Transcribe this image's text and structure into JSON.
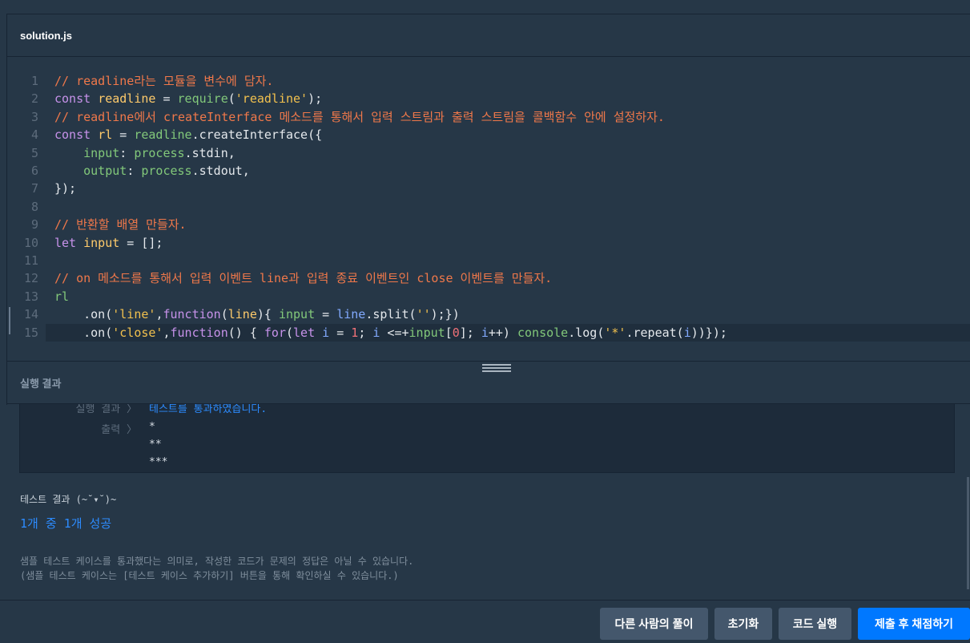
{
  "editor": {
    "file_name": "solution.js",
    "active_line": 15,
    "lines": [
      {
        "no": "1",
        "tokens": [
          [
            "c",
            "// readline라는 모듈을 변수에 담자."
          ]
        ]
      },
      {
        "no": "2",
        "tokens": [
          [
            "k",
            "const "
          ],
          [
            "v",
            "readline"
          ],
          [
            "p",
            " = "
          ],
          [
            "f",
            "require"
          ],
          [
            "p",
            "("
          ],
          [
            "s",
            "'readline'"
          ],
          [
            "p",
            ");"
          ]
        ]
      },
      {
        "no": "3",
        "tokens": [
          [
            "c",
            "// readline에서 createInterface 메소드를 통해서 입력 스트림과 출력 스트림을 콜백함수 안에 설정하자."
          ]
        ]
      },
      {
        "no": "4",
        "tokens": [
          [
            "k",
            "const "
          ],
          [
            "v",
            "rl"
          ],
          [
            "p",
            " = "
          ],
          [
            "f",
            "readline"
          ],
          [
            "p",
            ".createInterface({"
          ]
        ]
      },
      {
        "no": "5",
        "tokens": [
          [
            "p",
            "    "
          ],
          [
            "f",
            "input"
          ],
          [
            "p",
            ": "
          ],
          [
            "f",
            "process"
          ],
          [
            "p",
            ".stdin,"
          ]
        ]
      },
      {
        "no": "6",
        "tokens": [
          [
            "p",
            "    "
          ],
          [
            "f",
            "output"
          ],
          [
            "p",
            ": "
          ],
          [
            "f",
            "process"
          ],
          [
            "p",
            ".stdout,"
          ]
        ]
      },
      {
        "no": "7",
        "tokens": [
          [
            "p",
            "});"
          ]
        ]
      },
      {
        "no": "8",
        "tokens": []
      },
      {
        "no": "9",
        "tokens": [
          [
            "c",
            "// 반환할 배열 만들자."
          ]
        ]
      },
      {
        "no": "10",
        "tokens": [
          [
            "k",
            "let "
          ],
          [
            "v",
            "input"
          ],
          [
            "p",
            " = [];"
          ]
        ]
      },
      {
        "no": "11",
        "tokens": []
      },
      {
        "no": "12",
        "tokens": [
          [
            "c",
            "// on 메소드를 통해서 입력 이벤트 line과 입력 종료 이벤트인 close 이벤트를 만들자."
          ]
        ]
      },
      {
        "no": "13",
        "tokens": [
          [
            "f",
            "rl"
          ]
        ]
      },
      {
        "no": "14",
        "tokens": [
          [
            "p",
            "    .on("
          ],
          [
            "s",
            "'line'"
          ],
          [
            "p",
            ","
          ],
          [
            "k",
            "function"
          ],
          [
            "p",
            "("
          ],
          [
            "v",
            "line"
          ],
          [
            "p",
            "){ "
          ],
          [
            "f",
            "input"
          ],
          [
            "p",
            " = "
          ],
          [
            "b",
            "line"
          ],
          [
            "p",
            ".split("
          ],
          [
            "s",
            "''"
          ],
          [
            "p",
            ");})"
          ]
        ]
      },
      {
        "no": "15",
        "tokens": [
          [
            "p",
            "    .on("
          ],
          [
            "s",
            "'close'"
          ],
          [
            "p",
            ","
          ],
          [
            "k",
            "function"
          ],
          [
            "p",
            "() { "
          ],
          [
            "k",
            "for"
          ],
          [
            "p",
            "("
          ],
          [
            "k",
            "let "
          ],
          [
            "b",
            "i"
          ],
          [
            "p",
            " = "
          ],
          [
            "n",
            "1"
          ],
          [
            "p",
            "; "
          ],
          [
            "b",
            "i"
          ],
          [
            "p",
            " <=+"
          ],
          [
            "f",
            "input"
          ],
          [
            "p",
            "["
          ],
          [
            "n",
            "0"
          ],
          [
            "p",
            "]; "
          ],
          [
            "b",
            "i"
          ],
          [
            "p",
            "++) "
          ],
          [
            "f",
            "console"
          ],
          [
            "p",
            ".log("
          ],
          [
            "s",
            "'*'"
          ],
          [
            "p",
            ".repeat("
          ],
          [
            "b",
            "i"
          ],
          [
            "p",
            "))});"
          ]
        ]
      }
    ]
  },
  "result": {
    "title": "실행 결과",
    "run_label": "실행 결과 〉",
    "run_value": "테스트를 통과하였습니다.",
    "output_label": "출력 〉",
    "output_lines": [
      "*",
      "**",
      "***"
    ]
  },
  "tests": {
    "header": "테스트 결과 (~˘▾˘)~",
    "summary": "1개 중 1개 성공",
    "note1": "샘플 테스트 케이스를 통과했다는 의미로, 작성한 코드가 문제의 정답은 아닐 수 있습니다.",
    "note2": "(샘플 테스트 케이스는 [테스트 케이스 추가하기] 버튼을 통해 확인하실 수 있습니다.)"
  },
  "actions": {
    "others_solution": "다른 사람의 풀이",
    "reset": "초기화",
    "run_code": "코드 실행",
    "submit": "제출 후 채점하기"
  },
  "colors": {
    "background": "#263747",
    "comment": "#f0784a",
    "keyword": "#c792ea",
    "string": "#f2c14e",
    "success": "#2d8cff",
    "primary_button": "#0078ff",
    "secondary_button": "#44576c"
  }
}
